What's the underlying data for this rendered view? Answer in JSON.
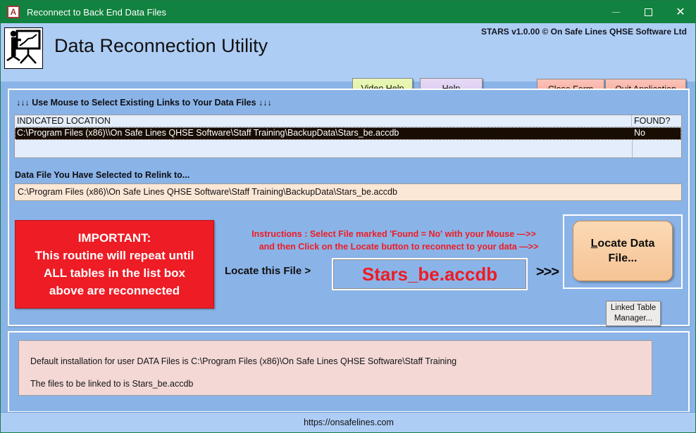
{
  "window": {
    "title": "Reconnect to Back End Data Files",
    "app_icon": "access-app-icon",
    "app_icon_letter": "A",
    "minimize_label": "—",
    "maximize_label": "□",
    "close_label": "✕",
    "titlebar_color": "#11823f"
  },
  "header": {
    "app_title": "Data Reconnection Utility",
    "brandline": "STARS v1.0.00 © On Safe Lines QHSE Software Ltd",
    "logo_icon": "presenter-flipchart-icon",
    "buttons": {
      "video_help": "Video Help",
      "video_help_accel": "V",
      "help": "Help",
      "help_accel": "H",
      "close_form": "Close Form",
      "close_form_accel": "C",
      "quit_application": "Quit Application",
      "quit_application_accel": "Q"
    }
  },
  "main": {
    "links_label": "↓↓↓ Use Mouse to Select Existing Links to Your Data Files ↓↓↓",
    "listbox": {
      "columns": [
        "INDICATED LOCATION",
        "FOUND?"
      ],
      "rows": [
        {
          "location": "C:\\Program Files (x86)\\\\On Safe Lines QHSE Software\\Staff Training\\BackupData\\Stars_be.accdb",
          "found": "No",
          "selected": true
        }
      ]
    },
    "relink_label": "Data File You Have Selected to Relink to...",
    "relink_path": "C:\\Program Files (x86)\\On Safe Lines QHSE Software\\Staff Training\\BackupData\\Stars_be.accdb",
    "important": {
      "line1": "IMPORTANT:",
      "line2": "This routine will repeat until",
      "line3": "ALL tables in the list box",
      "line4": "above are reconnected",
      "background": "#ee1c25",
      "text_color": "#ffffff"
    },
    "instructions": {
      "line1": "Instructions : Select File marked 'Found = No' with your Mouse —>>",
      "line2": "and then Click on the Locate button to reconnect to your data —>>",
      "color": "#ee1c24"
    },
    "locate_this_file_label": "Locate this File >",
    "target_filename": "Stars_be.accdb",
    "arrows": ">>>",
    "locate_button": "Locate Data File...",
    "locate_button_accel": "L",
    "linked_table_manager": "Linked Table Manager..."
  },
  "info": {
    "line1": "Default installation for user DATA Files is C:\\Program Files (x86)\\On Safe Lines QHSE Software\\Staff Training",
    "line2": "The files to be linked to is Stars_be.accdb"
  },
  "statusbar": {
    "url": "https://onsafelines.com"
  }
}
